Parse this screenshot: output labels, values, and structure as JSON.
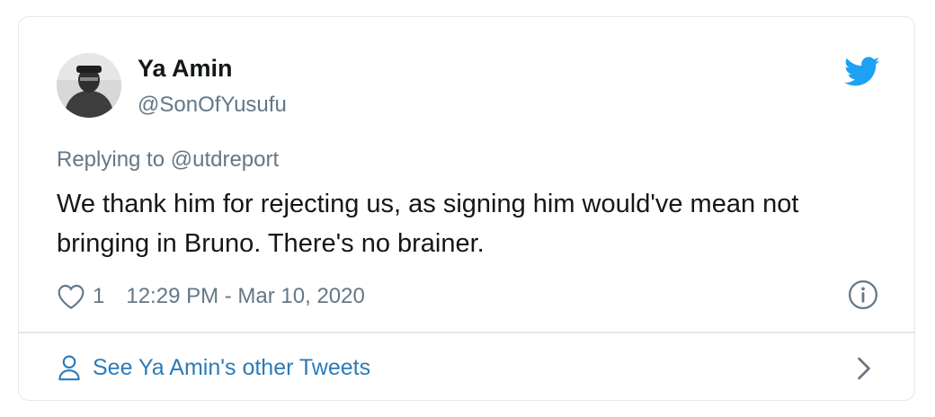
{
  "tweet": {
    "author_name": "Ya Amin",
    "author_handle": "@SonOfYusufu",
    "replying_to": "Replying to @utdreport",
    "text": "We thank him for rejecting us, as signing him would've mean not bringing in Bruno. There's no brainer.",
    "like_count": "1",
    "timestamp": "12:29 PM - Mar 10, 2020"
  },
  "footer": {
    "link_label": "See Ya Amin's other Tweets"
  },
  "icons": {
    "brand": "twitter-bird-icon",
    "like": "heart-icon",
    "info": "info-icon",
    "profile": "person-icon",
    "chevron": "chevron-right-icon"
  },
  "colors": {
    "brand_blue": "#1da1f2",
    "link_blue": "#2b7bb9",
    "text_primary": "#14171a",
    "text_secondary": "#657786",
    "border": "#e1e8ed"
  }
}
